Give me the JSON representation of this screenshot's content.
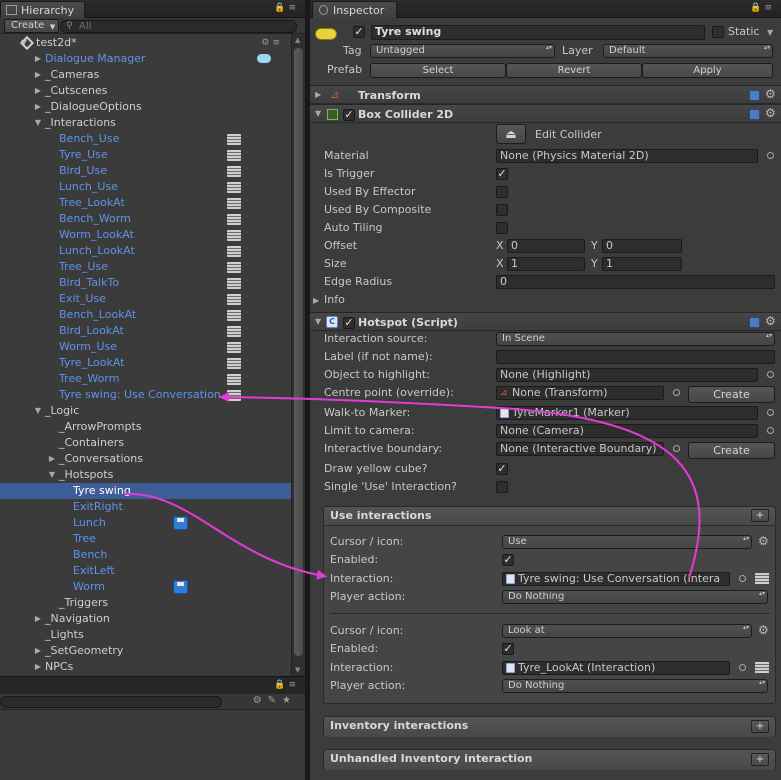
{
  "hierarchy": {
    "tab_label": "Hierarchy",
    "create_label": "Create",
    "search_placeholder": "All",
    "rows": [
      {
        "label": "test2d*",
        "indent": 0,
        "arrow": "open",
        "color": "white",
        "scene": true
      },
      {
        "label": "Dialogue Manager",
        "indent": 1,
        "arrow": "closed",
        "color": "blue",
        "special": "chat"
      },
      {
        "label": "_Cameras",
        "indent": 1,
        "arrow": "closed",
        "color": "white"
      },
      {
        "label": "_Cutscenes",
        "indent": 1,
        "arrow": "closed",
        "color": "white"
      },
      {
        "label": "_DialogueOptions",
        "indent": 1,
        "arrow": "closed",
        "color": "white"
      },
      {
        "label": "_Interactions",
        "indent": 1,
        "arrow": "open",
        "color": "white"
      },
      {
        "label": "Bench_Use",
        "indent": 2,
        "arrow": "none",
        "color": "blue",
        "stack": true
      },
      {
        "label": "Tyre_Use",
        "indent": 2,
        "arrow": "none",
        "color": "blue",
        "stack": true
      },
      {
        "label": "Bird_Use",
        "indent": 2,
        "arrow": "none",
        "color": "blue",
        "stack": true
      },
      {
        "label": "Lunch_Use",
        "indent": 2,
        "arrow": "none",
        "color": "blue",
        "stack": true
      },
      {
        "label": "Tree_LookAt",
        "indent": 2,
        "arrow": "none",
        "color": "blue",
        "stack": true
      },
      {
        "label": "Bench_Worm",
        "indent": 2,
        "arrow": "none",
        "color": "blue",
        "stack": true
      },
      {
        "label": "Worm_LookAt",
        "indent": 2,
        "arrow": "none",
        "color": "blue",
        "stack": true
      },
      {
        "label": "Lunch_LookAt",
        "indent": 2,
        "arrow": "none",
        "color": "blue",
        "stack": true
      },
      {
        "label": "Tree_Use",
        "indent": 2,
        "arrow": "none",
        "color": "blue",
        "stack": true
      },
      {
        "label": "Bird_TalkTo",
        "indent": 2,
        "arrow": "none",
        "color": "blue",
        "stack": true
      },
      {
        "label": "Exit_Use",
        "indent": 2,
        "arrow": "none",
        "color": "blue",
        "stack": true
      },
      {
        "label": "Bench_LookAt",
        "indent": 2,
        "arrow": "none",
        "color": "blue",
        "stack": true
      },
      {
        "label": "Bird_LookAt",
        "indent": 2,
        "arrow": "none",
        "color": "blue",
        "stack": true
      },
      {
        "label": "Worm_Use",
        "indent": 2,
        "arrow": "none",
        "color": "blue",
        "stack": true
      },
      {
        "label": "Tyre_LookAt",
        "indent": 2,
        "arrow": "none",
        "color": "blue",
        "stack": true
      },
      {
        "label": "Tree_Worm",
        "indent": 2,
        "arrow": "none",
        "color": "blue",
        "stack": true
      },
      {
        "label": "Tyre swing: Use Conversation",
        "indent": 2,
        "arrow": "none",
        "color": "blue",
        "stack": true
      },
      {
        "label": "_Logic",
        "indent": 1,
        "arrow": "open",
        "color": "white"
      },
      {
        "label": "_ArrowPrompts",
        "indent": 2,
        "arrow": "none",
        "color": "white"
      },
      {
        "label": "_Containers",
        "indent": 2,
        "arrow": "none",
        "color": "white"
      },
      {
        "label": "_Conversations",
        "indent": 2,
        "arrow": "closed",
        "color": "white"
      },
      {
        "label": "_Hotspots",
        "indent": 2,
        "arrow": "open",
        "color": "white"
      },
      {
        "label": "Tyre swing",
        "indent": 3,
        "arrow": "none",
        "color": "white",
        "selected": true
      },
      {
        "label": "ExitRight",
        "indent": 3,
        "arrow": "none",
        "color": "blue"
      },
      {
        "label": "Lunch",
        "indent": 3,
        "arrow": "none",
        "color": "blue",
        "disk": true
      },
      {
        "label": "Tree",
        "indent": 3,
        "arrow": "none",
        "color": "blue"
      },
      {
        "label": "Bench",
        "indent": 3,
        "arrow": "none",
        "color": "blue"
      },
      {
        "label": "ExitLeft",
        "indent": 3,
        "arrow": "none",
        "color": "blue"
      },
      {
        "label": "Worm",
        "indent": 3,
        "arrow": "none",
        "color": "blue",
        "disk": true
      },
      {
        "label": "_Triggers",
        "indent": 2,
        "arrow": "none",
        "color": "white"
      },
      {
        "label": "_Navigation",
        "indent": 1,
        "arrow": "closed",
        "color": "white"
      },
      {
        "label": "_Lights",
        "indent": 1,
        "arrow": "none",
        "color": "white"
      },
      {
        "label": "_SetGeometry",
        "indent": 1,
        "arrow": "closed",
        "color": "white"
      },
      {
        "label": "NPCs",
        "indent": 1,
        "arrow": "closed",
        "color": "white"
      }
    ]
  },
  "inspector": {
    "tab_label": "Inspector",
    "object_name": "Tyre swing",
    "static_label": "Static",
    "tag_label": "Tag",
    "tag_value": "Untagged",
    "layer_label": "Layer",
    "layer_value": "Default",
    "prefab_label": "Prefab",
    "prefab_select": "Select",
    "prefab_revert": "Revert",
    "prefab_apply": "Apply",
    "transform": {
      "title": "Transform"
    },
    "box_collider": {
      "title": "Box Collider 2D",
      "edit_collider": "Edit Collider",
      "material_label": "Material",
      "material_value": "None (Physics Material 2D)",
      "is_trigger_label": "Is Trigger",
      "used_by_effector_label": "Used By Effector",
      "used_by_composite_label": "Used By Composite",
      "auto_tiling_label": "Auto Tiling",
      "offset_label": "Offset",
      "offset_x": "0",
      "offset_y": "0",
      "size_label": "Size",
      "size_x": "1",
      "size_y": "1",
      "edge_radius_label": "Edge Radius",
      "edge_radius_value": "0",
      "info_label": "Info",
      "x_label": "X",
      "y_label": "Y"
    },
    "hotspot": {
      "title": "Hotspot (Script)",
      "interaction_source_label": "Interaction source:",
      "interaction_source_value": "In Scene",
      "label_label": "Label (if not name):",
      "label_value": "",
      "object_to_highlight_label": "Object to highlight:",
      "object_to_highlight_value": "None (Highlight)",
      "centre_point_label": "Centre point (override):",
      "centre_point_value": "None (Transform)",
      "create_label": "Create",
      "walk_to_label": "Walk-to Marker:",
      "walk_to_value": "TyreMarker1 (Marker)",
      "limit_camera_label": "Limit to camera:",
      "limit_camera_value": "None (Camera)",
      "boundary_label": "Interactive boundary:",
      "boundary_value": "None (Interactive Boundary)",
      "yellow_cube_label": "Draw yellow cube?",
      "single_use_label": "Single 'Use' Interaction?"
    },
    "use_interactions": {
      "title": "Use interactions",
      "plus": "+",
      "items": [
        {
          "cursor_label": "Cursor / icon:",
          "cursor_value": "Use",
          "enabled_label": "Enabled:",
          "interaction_label": "Interaction:",
          "interaction_value": "Tyre swing: Use Conversation (Intera",
          "player_action_label": "Player action:",
          "player_action_value": "Do Nothing"
        },
        {
          "cursor_label": "Cursor / icon:",
          "cursor_value": "Look at",
          "enabled_label": "Enabled:",
          "interaction_label": "Interaction:",
          "interaction_value": "Tyre_LookAt (Interaction)",
          "player_action_label": "Player action:",
          "player_action_value": "Do Nothing"
        }
      ]
    },
    "inventory_interactions": {
      "title": "Inventory interactions",
      "plus": "+"
    },
    "unhandled_inventory": {
      "title": "Unhandled Inventory interaction",
      "plus": "+"
    }
  },
  "colors": {
    "magenta_arrow": "#e43bd8",
    "selection": "#3d5d96",
    "prefab_blue": "#5e93e6"
  }
}
